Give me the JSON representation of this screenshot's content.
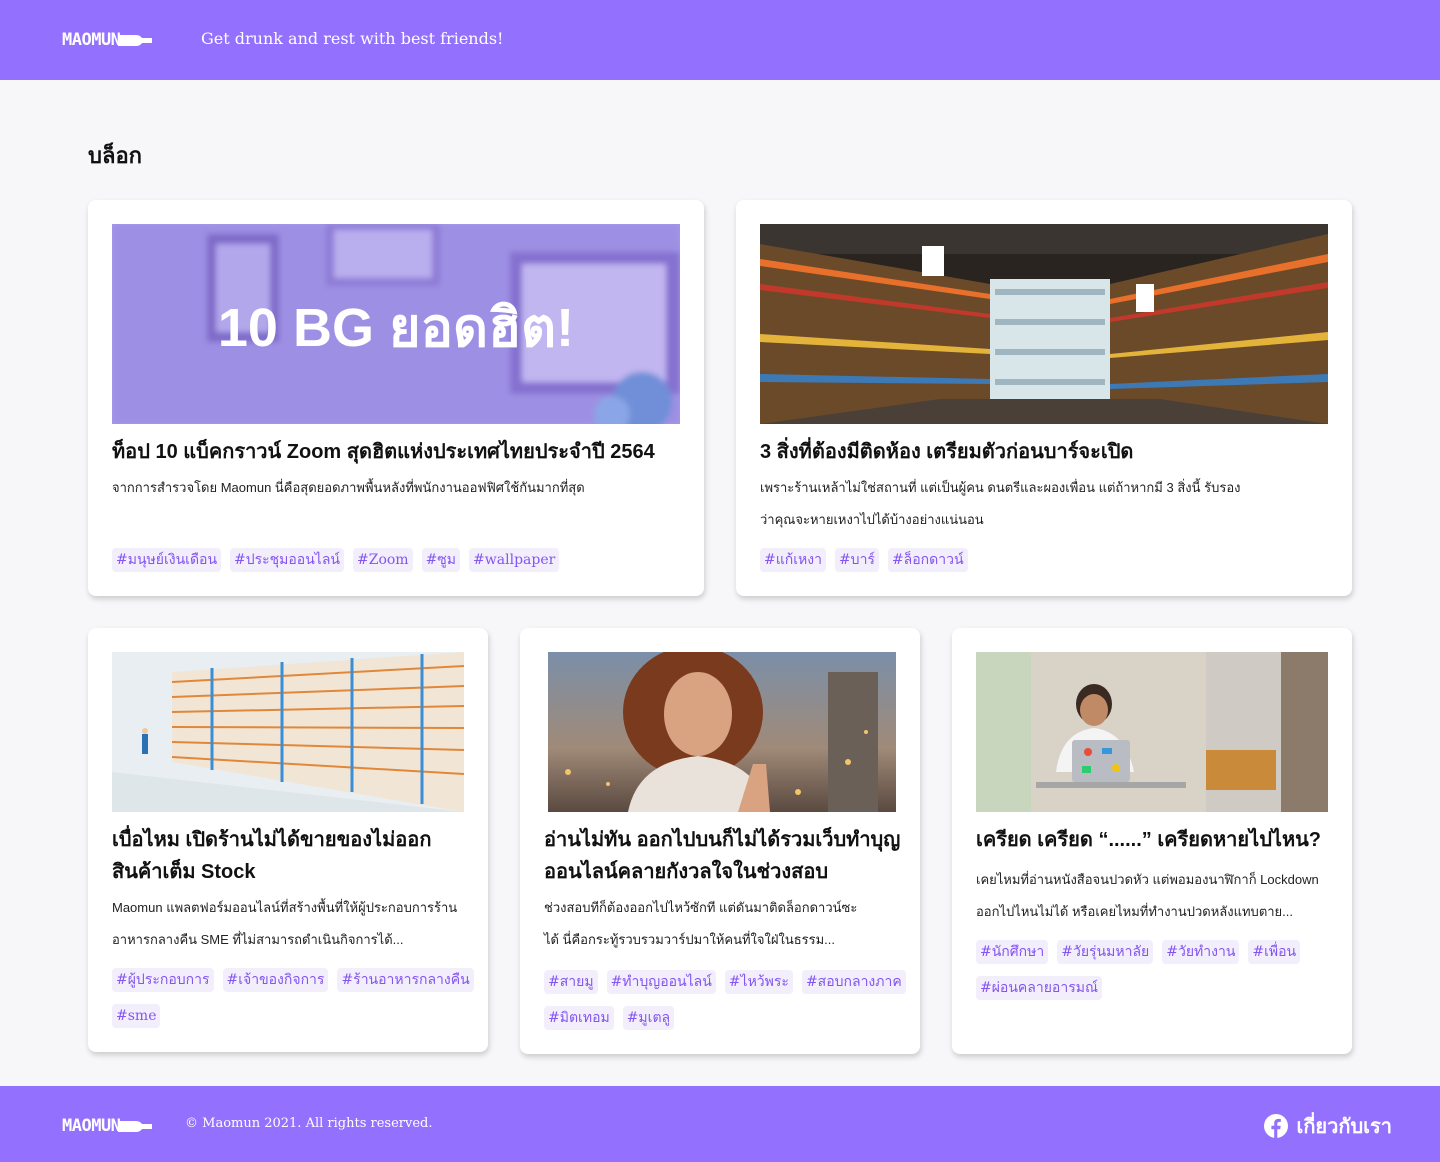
{
  "header": {
    "logo_text": "MAOMUN",
    "tagline": "Get drunk and rest with best friends!"
  },
  "page_title": "บล็อก",
  "posts": [
    {
      "image_text": "10 BG ยอดฮิต!",
      "title": "ท็อป 10 แบ็คกราวน์ Zoom สุดฮิตแห่งประเทศไทยประจำปี 2564",
      "excerpt": "จากการสำรวจโดย Maomun นี่คือสุดยอดภาพพื้นหลังที่พนักงานออฟฟิศใช้กันมากที่สุด",
      "tags": [
        "#มนุษย์เงินเดือน",
        "#ประชุมออนไลน์",
        "#Zoom",
        "#ซูม",
        "#wallpaper"
      ]
    },
    {
      "title": "3 สิ่งที่ต้องมีติดห้อง เตรียมตัวก่อนบาร์จะเปิด",
      "excerpt": "เพราะร้านเหล้าไม่ใช่สถานที่ แต่เป็นผู้คน ดนตรีและผองเพื่อน แต่ถ้าหากมี 3 สิ่งนี้ รับรองว่าคุณจะหายเหงาไปได้บ้างอย่างแน่นอน",
      "tags": [
        "#แก้เหงา",
        "#บาร์",
        "#ล็อกดาวน์"
      ]
    },
    {
      "title": "เบื่อไหม เปิดร้านไม่ได้ขายของไม่ออก สินค้าเต็ม Stock",
      "excerpt": "Maomun แพลตฟอร์มออนไลน์ที่สร้างพื้นที่ให้ผู้ประกอบการร้านอาหารกลางคืน SME ที่ไม่สามารถดำเนินกิจการได้...",
      "tags": [
        "#ผู้ประกอบการ",
        "#เจ้าของกิจการ",
        "#ร้านอาหารกลางคืน",
        "#sme"
      ]
    },
    {
      "title": "อ่านไม่ทัน ออกไปบนก็ไม่ได้รวมเว็บทำบุญออนไลน์คลายกังวลใจในช่วงสอบ",
      "excerpt": "ช่วงสอบทีก็ต้องออกไปไหว้ซักที แต่ดันมาติดล็อกดาวน์ซะได้ นี่คือกระทู้รวบรวมวาร์ปมาให้คนที่ใจใฝ่ในธรรม...",
      "tags": [
        "#สายมู",
        "#ทำบุญออนไลน์",
        "#ไหว้พระ",
        "#สอบกลางภาค",
        "#มิตเทอม",
        "#มูเตลู"
      ]
    },
    {
      "title": "เครียด เครียด “......” เครียดหายไปไหน?",
      "excerpt": "เคยไหมที่อ่านหนังสือจนปวดหัว แต่พอมองนาฬิกาก็ Lockdown ออกไปไหนไม่ได้ หรือเคยไหมที่ทำงานปวดหลังแทบตาย...",
      "tags": [
        "#นักศึกษา",
        "#วัยรุ่นมหาลัย",
        "#วัยทำงาน",
        "#เพื่อน",
        "#ผ่อนคลายอารมณ์"
      ]
    }
  ],
  "footer": {
    "logo_text": "MAOMUN",
    "copyright": "© Maomun 2021. All rights reserved.",
    "about_label": "เกี่ยวกับเรา"
  },
  "colors": {
    "brand": "#9370fd",
    "tag_text": "#8455f0",
    "tag_bg": "#f2eefc"
  },
  "icons": {
    "footer_link": "facebook-icon",
    "logo_mark": "bottle-icon"
  }
}
